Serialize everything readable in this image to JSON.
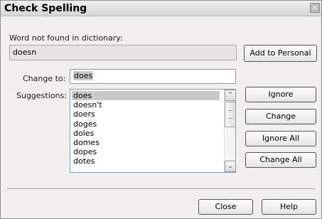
{
  "window": {
    "title": "Check Spelling",
    "close_glyph": "×"
  },
  "not_found": {
    "label": "Word not found in dictionary:",
    "value": "doesn"
  },
  "change_to": {
    "label": "Change to:",
    "value": "does"
  },
  "suggestions": {
    "label": "Suggestions:",
    "items": [
      "does",
      "doesn't",
      "doers",
      "doges",
      "doles",
      "domes",
      "dopes",
      "dotes"
    ],
    "selected_index": 0
  },
  "scrollbar": {
    "up_glyph": "⌃",
    "down_glyph": "⌄"
  },
  "buttons": {
    "add_to_personal": "Add to Personal",
    "ignore": "Ignore",
    "change": "Change",
    "ignore_all": "Ignore All",
    "change_all": "Change All",
    "close": "Close",
    "help": "Help"
  }
}
